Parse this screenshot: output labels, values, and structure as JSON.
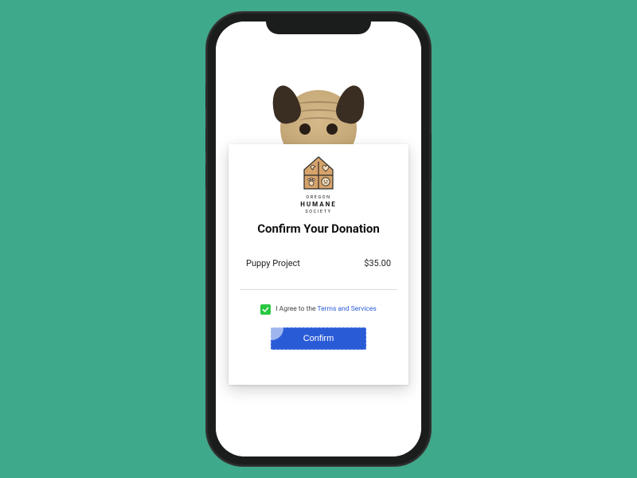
{
  "background_color": "#3fa98c",
  "org": {
    "line1": "OREGON",
    "line2": "HUMANE",
    "line3": "SOCIETY",
    "logo_color": "#d6a36b",
    "logo_outline": "#2b2b2b"
  },
  "card": {
    "title": "Confirm Your Donation",
    "donation": {
      "item": "Puppy Project",
      "amount": "$35.00"
    },
    "agree": {
      "checked": true,
      "checkbox_color": "#28c840",
      "prefix": "I Agree to the ",
      "link_text": "Terms and Services"
    },
    "confirm_label": "Confirm",
    "confirm_color": "#2a5bd7"
  }
}
